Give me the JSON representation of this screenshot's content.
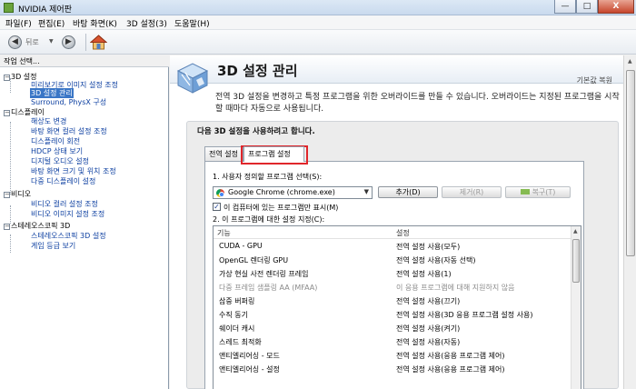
{
  "window": {
    "title": "NVIDIA 제어판",
    "min": "—",
    "max": "□",
    "close": "X"
  },
  "menu": [
    "파일(F)",
    "편집(E)",
    "바탕 화면(K)",
    "3D 설정(3)",
    "도움말(H)"
  ],
  "toolbar": {
    "back": "뒤로",
    "back_glyph": "◀",
    "forward_glyph": "▶",
    "dropdown_glyph": "▼"
  },
  "left": {
    "header": "작업 선택...",
    "tree": [
      {
        "label": "3D 설정",
        "type": "top"
      },
      {
        "label": "미리보기로 이미지 설정 조정",
        "type": "child"
      },
      {
        "label": "3D 설정 관리",
        "type": "child",
        "selected": true
      },
      {
        "label": "Surround, PhysX 구성",
        "type": "child"
      },
      {
        "label": "디스플레이",
        "type": "top"
      },
      {
        "label": "해상도 변경",
        "type": "child"
      },
      {
        "label": "바탕 화면 컬러 설정 조정",
        "type": "child"
      },
      {
        "label": "디스플레이 회전",
        "type": "child"
      },
      {
        "label": "HDCP 상태 보기",
        "type": "child"
      },
      {
        "label": "디지털 오디오 설정",
        "type": "child"
      },
      {
        "label": "바탕 화면 크기 및 위치 조정",
        "type": "child"
      },
      {
        "label": "다중 디스플레이 설정",
        "type": "child"
      },
      {
        "label": "비디오",
        "type": "top"
      },
      {
        "label": "비디오 컬러 설정 조정",
        "type": "child"
      },
      {
        "label": "비디오 이미지 설정 조정",
        "type": "child"
      },
      {
        "label": "스테레오스코픽 3D",
        "type": "top"
      },
      {
        "label": "스테레오스코픽 3D 설정",
        "type": "child"
      },
      {
        "label": "게임 등급 보기",
        "type": "child"
      }
    ],
    "expander": "−"
  },
  "right": {
    "title": "3D 설정 관리",
    "restore": "기본값 복원",
    "description": "전역 3D 설정을 변경하고 특정 프로그램을 위한 오버라이드를 만들 수 있습니다. 오버라이드는 지정된 프로그램을 시작할 때마다 자동으로 사용됩니다.",
    "group_heading": "다음 3D 설정을 사용하려고 합니다.",
    "tabs": {
      "global": "전역 설정",
      "program": "프로그램 설정"
    },
    "step1": "1. 사용자 정의할 프로그램 선택(S):",
    "program_value": "Google Chrome (chrome.exe)",
    "select_arrow": "▼",
    "buttons": {
      "add": "추가(D)",
      "remove": "제거(R)",
      "restore": "복구(T)"
    },
    "checkbox": {
      "checked": true,
      "mark": "✓",
      "label": "이 컴퓨터에 있는 프로그램만 표시(M)"
    },
    "step2": "2. 이 프로그램에 대한 설정 지정(C):",
    "table": {
      "headers": [
        "기능",
        "설정"
      ],
      "rows": [
        {
          "feature": "CUDA - GPU",
          "setting": "전역 설정 사용(모두)",
          "muted": false
        },
        {
          "feature": "OpenGL 렌더링 GPU",
          "setting": "전역 설정 사용(자동 선택)",
          "muted": false
        },
        {
          "feature": "가상 현실 사전 렌더링 프레임",
          "setting": "전역 설정 사용(1)",
          "muted": false
        },
        {
          "feature": "다중 프레임 샘플링 AA (MFAA)",
          "setting": "이 응용 프로그램에 대해 지원하지 않음",
          "muted": true
        },
        {
          "feature": "삼중 버퍼링",
          "setting": "전역 설정 사용(끄기)",
          "muted": false
        },
        {
          "feature": "수직 동기",
          "setting": "전역 설정 사용(3D 응용 프로그램 설정 사용)",
          "muted": false
        },
        {
          "feature": "쉐이더 캐시",
          "setting": "전역 설정 사용(켜기)",
          "muted": false
        },
        {
          "feature": "스레드 최적화",
          "setting": "전역 설정 사용(자동)",
          "muted": false
        },
        {
          "feature": "앤티엘리어싱 - 모드",
          "setting": "전역 설정 사용(응용 프로그램 제어)",
          "muted": false
        },
        {
          "feature": "앤티엘리어싱 - 설정",
          "setting": "전역 설정 사용(응용 프로그램 제어)",
          "muted": false
        }
      ]
    }
  },
  "scroll_glyph": "▲"
}
